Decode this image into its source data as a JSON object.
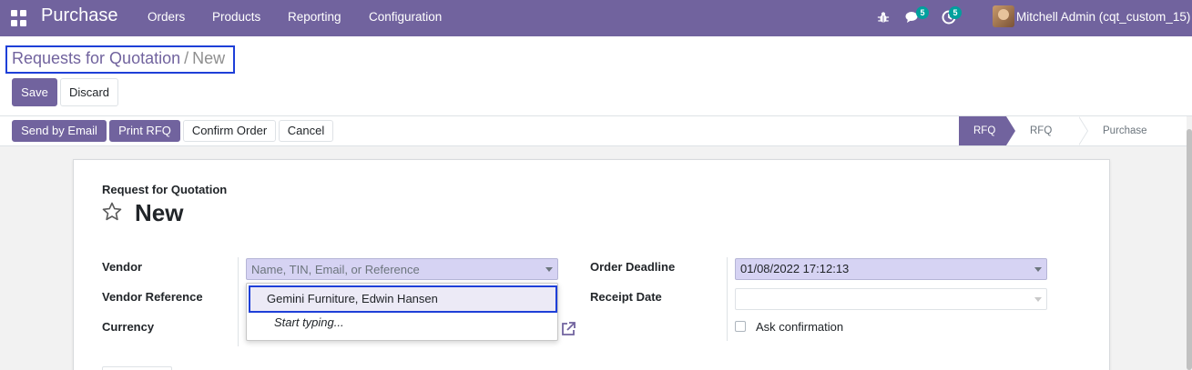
{
  "navbar": {
    "brand": "Purchase",
    "menus": [
      "Orders",
      "Products",
      "Reporting",
      "Configuration"
    ],
    "messages_badge": "5",
    "activities_badge": "5",
    "user_name": "Mitchell Admin (cqt_custom_15)",
    "bg_color": "#71639e"
  },
  "breadcrumb": {
    "parent": "Requests for Quotation",
    "separator": "/",
    "current": "New"
  },
  "actions": {
    "save": "Save",
    "discard": "Discard"
  },
  "header_buttons": {
    "send_email": "Send by Email",
    "print_rfq": "Print RFQ",
    "confirm_order": "Confirm Order",
    "cancel": "Cancel"
  },
  "stages": [
    "RFQ",
    "RFQ Sent",
    "Purchase Order"
  ],
  "form": {
    "subtitle": "Request for Quotation",
    "title": "New",
    "left_fields": {
      "vendor_label": "Vendor",
      "vendor_placeholder": "Name, TIN, Email, or Reference",
      "vendor_reference_label": "Vendor Reference",
      "currency_label": "Currency"
    },
    "right_fields": {
      "order_deadline_label": "Order Deadline",
      "order_deadline_value": "01/08/2022 17:12:13",
      "receipt_date_label": "Receipt Date",
      "ask_confirmation_label": "Ask confirmation"
    },
    "vendor_dropdown": {
      "option": "Gemini Furniture, Edwin Hansen",
      "hint": "Start typing..."
    }
  },
  "icons": {
    "apps": "apps-grid-icon",
    "bug": "bug-icon",
    "messages": "chat-icon",
    "activities": "clock-icon",
    "star": "star-icon",
    "external": "external-link-icon"
  },
  "colors": {
    "primary": "#71639e",
    "highlight": "#1e3fd8",
    "field_required": "#d6d3f3",
    "badge": "#00a09d"
  }
}
